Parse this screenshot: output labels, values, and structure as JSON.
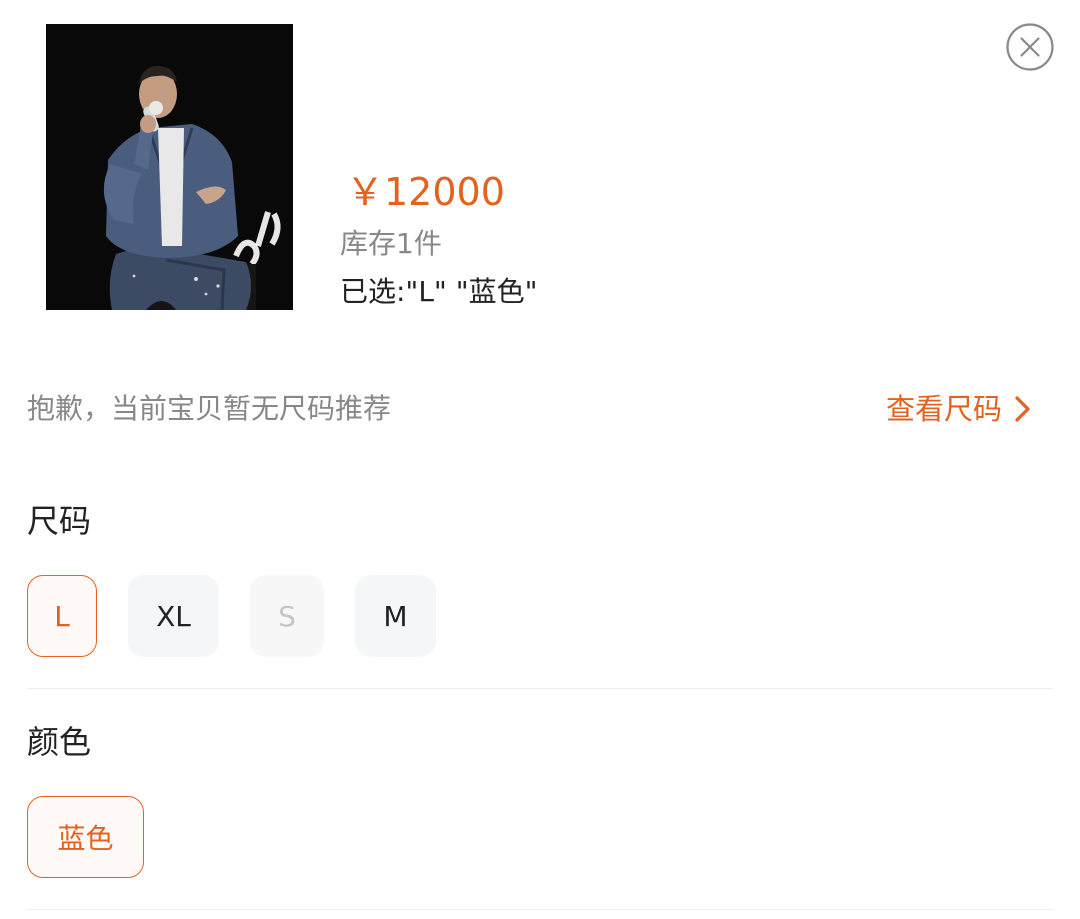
{
  "product": {
    "price": "￥12000",
    "stock": "库存1件",
    "selected": "已选:\"L\" \"蓝色\"",
    "image_icon": "product-photo"
  },
  "close": {
    "icon": "close-circle-icon"
  },
  "size_tip": {
    "text": "抱歉，当前宝贝暂无尺码推荐",
    "link_label": "查看尺码",
    "link_icon": "chevron-right-icon"
  },
  "size_section": {
    "title": "尺码",
    "options": [
      {
        "label": "L",
        "state": "selected"
      },
      {
        "label": "XL",
        "state": "normal"
      },
      {
        "label": "S",
        "state": "disabled"
      },
      {
        "label": "M",
        "state": "normal"
      }
    ]
  },
  "color_section": {
    "title": "颜色",
    "options": [
      {
        "label": "蓝色",
        "state": "selected"
      }
    ]
  },
  "colors": {
    "accent": "#e4621f",
    "muted_text": "#888888",
    "option_bg": "#f5f6f8"
  }
}
